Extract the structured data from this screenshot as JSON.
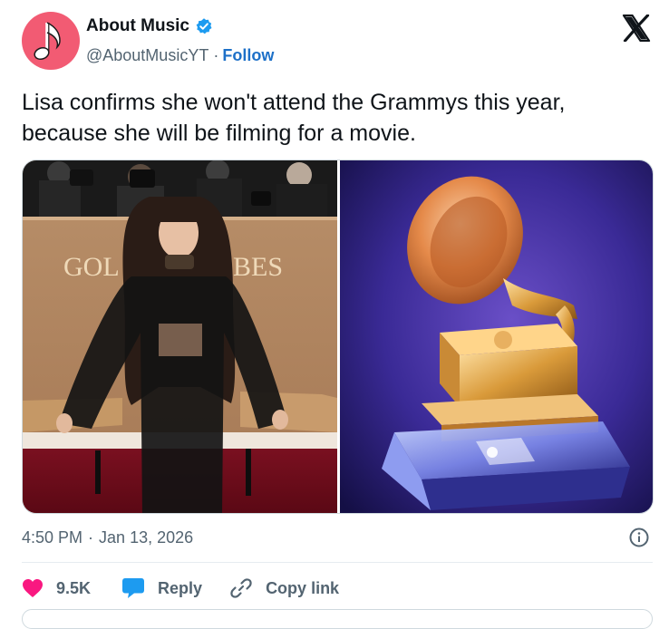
{
  "author": {
    "display_name": "About Music",
    "handle": "@AboutMusicYT",
    "separator": "·",
    "follow_label": "Follow",
    "avatar_icon": "music-note-icon",
    "verified_icon": "verified-badge-icon",
    "avatar_color": "#f25b73"
  },
  "platform_icon": "x-logo-icon",
  "tweet": {
    "text": "Lisa confirms she won't attend the Grammys this year, because she will be filming for a movie."
  },
  "media": {
    "left_photo": {
      "backdrop_text_left": "GOL",
      "backdrop_text_right": "BES"
    },
    "right_photo": {
      "subject": "gramophone-trophy"
    }
  },
  "timestamp": {
    "time": "4:50 PM",
    "separator": "·",
    "date": "Jan 13, 2026"
  },
  "actions": {
    "likes_count": "9.5K",
    "reply_label": "Reply",
    "copy_link_label": "Copy link"
  },
  "colors": {
    "accent": "#1d70c8",
    "like": "#f91880",
    "reply": "#1d9bf0",
    "muted_text": "#536471"
  }
}
